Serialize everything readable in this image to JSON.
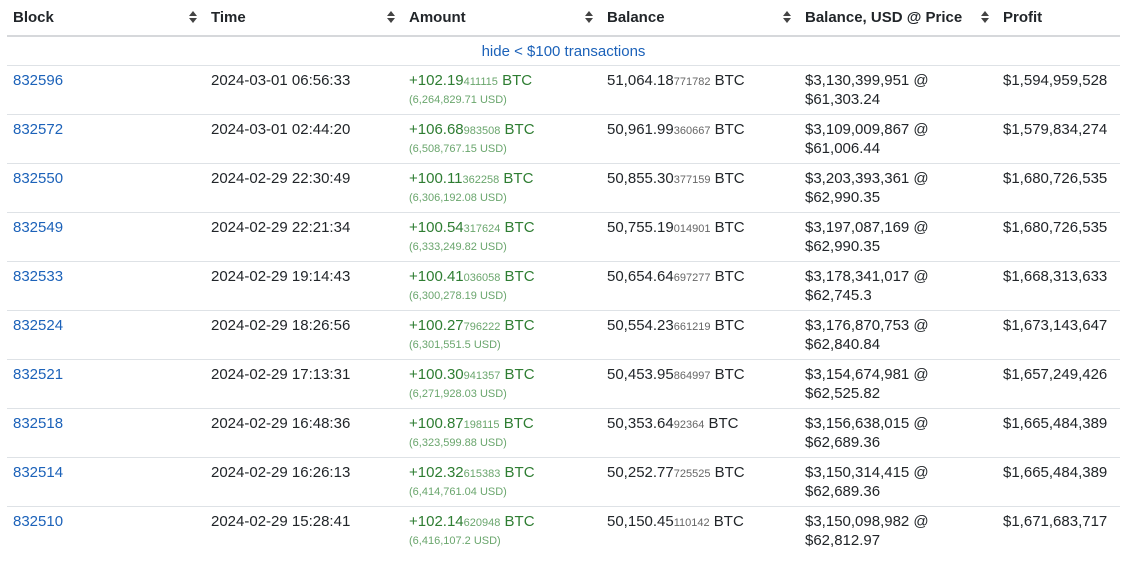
{
  "headers": [
    "Block",
    "Time",
    "Amount",
    "Balance",
    "Balance, USD @ Price",
    "Profit"
  ],
  "filter_link": "hide < $100 transactions",
  "rows": [
    {
      "block": "832596",
      "time": "2024-03-01 06:56:33",
      "amt_main": "+102.19",
      "amt_small": "411115",
      "amt_unit": " BTC",
      "amt_usd": "(6,264,829.71 USD)",
      "bal_main": "51,064.18",
      "bal_small": "771782",
      "bal_unit": " BTC",
      "bal_usd": "$3,130,399,951 @",
      "price": "$61,303.24",
      "profit": "$1,594,959,528"
    },
    {
      "block": "832572",
      "time": "2024-03-01 02:44:20",
      "amt_main": "+106.68",
      "amt_small": "983508",
      "amt_unit": " BTC",
      "amt_usd": "(6,508,767.15 USD)",
      "bal_main": "50,961.99",
      "bal_small": "360667",
      "bal_unit": " BTC",
      "bal_usd": "$3,109,009,867 @",
      "price": "$61,006.44",
      "profit": "$1,579,834,274"
    },
    {
      "block": "832550",
      "time": "2024-02-29 22:30:49",
      "amt_main": "+100.11",
      "amt_small": "362258",
      "amt_unit": " BTC",
      "amt_usd": "(6,306,192.08 USD)",
      "bal_main": "50,855.30",
      "bal_small": "377159",
      "bal_unit": " BTC",
      "bal_usd": "$3,203,393,361 @",
      "price": "$62,990.35",
      "profit": "$1,680,726,535"
    },
    {
      "block": "832549",
      "time": "2024-02-29 22:21:34",
      "amt_main": "+100.54",
      "amt_small": "317624",
      "amt_unit": " BTC",
      "amt_usd": "(6,333,249.82 USD)",
      "bal_main": "50,755.19",
      "bal_small": "014901",
      "bal_unit": " BTC",
      "bal_usd": "$3,197,087,169 @",
      "price": "$62,990.35",
      "profit": "$1,680,726,535"
    },
    {
      "block": "832533",
      "time": "2024-02-29 19:14:43",
      "amt_main": "+100.41",
      "amt_small": "036058",
      "amt_unit": " BTC",
      "amt_usd": "(6,300,278.19 USD)",
      "bal_main": "50,654.64",
      "bal_small": "697277",
      "bal_unit": " BTC",
      "bal_usd": "$3,178,341,017 @",
      "price": "$62,745.3",
      "profit": "$1,668,313,633"
    },
    {
      "block": "832524",
      "time": "2024-02-29 18:26:56",
      "amt_main": "+100.27",
      "amt_small": "796222",
      "amt_unit": " BTC",
      "amt_usd": "(6,301,551.5 USD)",
      "bal_main": "50,554.23",
      "bal_small": "661219",
      "bal_unit": " BTC",
      "bal_usd": "$3,176,870,753 @",
      "price": "$62,840.84",
      "profit": "$1,673,143,647"
    },
    {
      "block": "832521",
      "time": "2024-02-29 17:13:31",
      "amt_main": "+100.30",
      "amt_small": "941357",
      "amt_unit": " BTC",
      "amt_usd": "(6,271,928.03 USD)",
      "bal_main": "50,453.95",
      "bal_small": "864997",
      "bal_unit": " BTC",
      "bal_usd": "$3,154,674,981 @",
      "price": "$62,525.82",
      "profit": "$1,657,249,426"
    },
    {
      "block": "832518",
      "time": "2024-02-29 16:48:36",
      "amt_main": "+100.87",
      "amt_small": "198115",
      "amt_unit": " BTC",
      "amt_usd": "(6,323,599.88 USD)",
      "bal_main": "50,353.64",
      "bal_small": "92364",
      "bal_unit": " BTC",
      "bal_usd": "$3,156,638,015 @",
      "price": "$62,689.36",
      "profit": "$1,665,484,389"
    },
    {
      "block": "832514",
      "time": "2024-02-29 16:26:13",
      "amt_main": "+102.32",
      "amt_small": "615383",
      "amt_unit": " BTC",
      "amt_usd": "(6,414,761.04 USD)",
      "bal_main": "50,252.77",
      "bal_small": "725525",
      "bal_unit": " BTC",
      "bal_usd": "$3,150,314,415 @",
      "price": "$62,689.36",
      "profit": "$1,665,484,389"
    },
    {
      "block": "832510",
      "time": "2024-02-29 15:28:41",
      "amt_main": "+102.14",
      "amt_small": "620948",
      "amt_unit": " BTC",
      "amt_usd": "(6,416,107.2 USD)",
      "bal_main": "50,150.45",
      "bal_small": "110142",
      "bal_unit": " BTC",
      "bal_usd": "$3,150,098,982 @",
      "price": "$62,812.97",
      "profit": "$1,671,683,717"
    }
  ]
}
